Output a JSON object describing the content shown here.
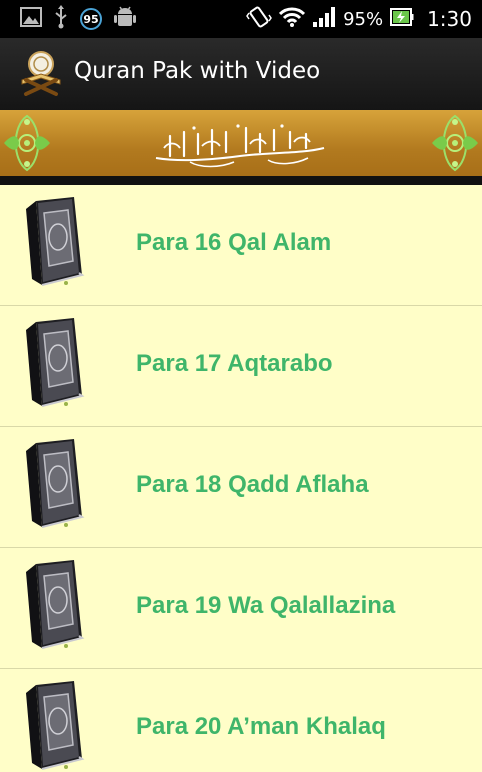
{
  "status_bar": {
    "notification_badge": "95",
    "battery_percent": "95%",
    "time": "1:30"
  },
  "action_bar": {
    "title": "Quran Pak with Video"
  },
  "banner": {
    "text": "بسم الله الرحمن الرحيم"
  },
  "list": {
    "items": [
      {
        "label": "Para 16 Qal Alam"
      },
      {
        "label": "Para 17 Aqtarabo"
      },
      {
        "label": "Para 18 Qadd Aflaha"
      },
      {
        "label": "Para 19 Wa Qalallazina"
      },
      {
        "label": "Para 20 A’man Khalaq"
      }
    ]
  },
  "colors": {
    "list_background": "#fffec8",
    "item_text": "#3fb56a",
    "banner_gold": "#b8801f",
    "action_bar": "#1e1e1e",
    "status_bar": "#000000"
  },
  "icons": {
    "status_left": [
      "image-icon",
      "usb-icon",
      "badge-95-icon",
      "android-icon"
    ],
    "status_right": [
      "vibrate-icon",
      "wifi-icon",
      "signal-icon",
      "battery-charging-icon"
    ],
    "app": "quran-rehal-icon",
    "list_item": "quran-book-icon",
    "banner": [
      "floral-ornament-icon",
      "bismillah-calligraphy-icon"
    ]
  }
}
